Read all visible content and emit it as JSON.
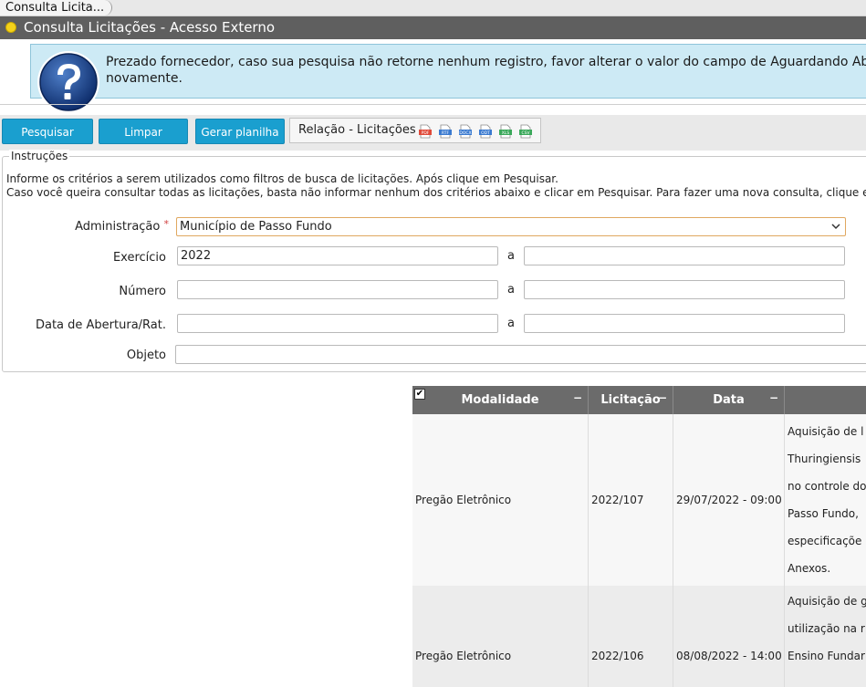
{
  "tab": {
    "label": "Consulta Licita..."
  },
  "window": {
    "title": "Consulta Licitações - Acesso Externo"
  },
  "info": {
    "line1": "Prezado fornecedor, caso sua pesquisa não retorne nenhum registro, favor alterar o valor do campo de Aguardando Ab",
    "line2": "novamente."
  },
  "toolbar": {
    "search_label": "Pesquisar",
    "clear_label": "Limpar",
    "spreadsheet_label": "Gerar planilha",
    "report_label": "Relação - Licitações",
    "exports": [
      {
        "icon": "pdf-file-icon",
        "text": "PDF",
        "color": "#e04a3a"
      },
      {
        "icon": "rtf-file-icon",
        "text": "RTF",
        "color": "#3a7ad0"
      },
      {
        "icon": "docx-file-icon",
        "text": "DOCX",
        "color": "#3a7ad0"
      },
      {
        "icon": "odt-file-icon",
        "text": "ODT",
        "color": "#3a7ad0"
      },
      {
        "icon": "xls-file-icon",
        "text": "XLS",
        "color": "#3aa85a"
      },
      {
        "icon": "csv-file-icon",
        "text": "CSV",
        "color": "#3aa85a"
      }
    ]
  },
  "instructions": {
    "legend": "Instruções",
    "line1": "Informe os critérios a serem utilizados como filtros de busca de licitações. Após clique em Pesquisar.",
    "line2": "Caso você queira consultar todas as licitações, basta não informar nenhum dos critérios abaixo e clicar em Pesquisar. Para fazer uma nova consulta, clique e"
  },
  "form": {
    "administracao_label": "Administração",
    "required_mark": "*",
    "administracao_value": "Município de Passo Fundo",
    "exercicio_label": "Exercício",
    "exercicio_from": "2022",
    "exercicio_to": "",
    "numero_label": "Número",
    "numero_from": "",
    "numero_to": "",
    "data_label": "Data de Abertura/Rat.",
    "data_from": "",
    "data_to": "",
    "objeto_label": "Objeto",
    "objeto_value": "",
    "range_sep": "a"
  },
  "table": {
    "check_mark": "✔",
    "collapse_mark": "−",
    "headers": {
      "modalidade": "Modalidade",
      "licitacao": "Licitação",
      "data": "Data"
    },
    "rows": [
      {
        "modalidade": "Pregão Eletrônico",
        "licitacao": "2022/107",
        "data": "29/07/2022 - 09:00",
        "objeto_lines": [
          "Aquisição de l",
          "Thuringiensis",
          "no controle do",
          "Passo Fundo,",
          "especificaçõe",
          "Anexos."
        ]
      },
      {
        "modalidade": "Pregão Eletrônico",
        "licitacao": "2022/106",
        "data": "08/08/2022 - 14:00",
        "objeto_lines": [
          "Aquisição de g",
          "utilização na r",
          "Ensino Fundar"
        ]
      }
    ]
  },
  "colors": {
    "accent": "#1a9fcf",
    "titlebar": "#5f5f5f",
    "info_bg": "#cdeaf5",
    "grid_header": "#6b6b6b",
    "status_dot": "#f5d21a"
  }
}
